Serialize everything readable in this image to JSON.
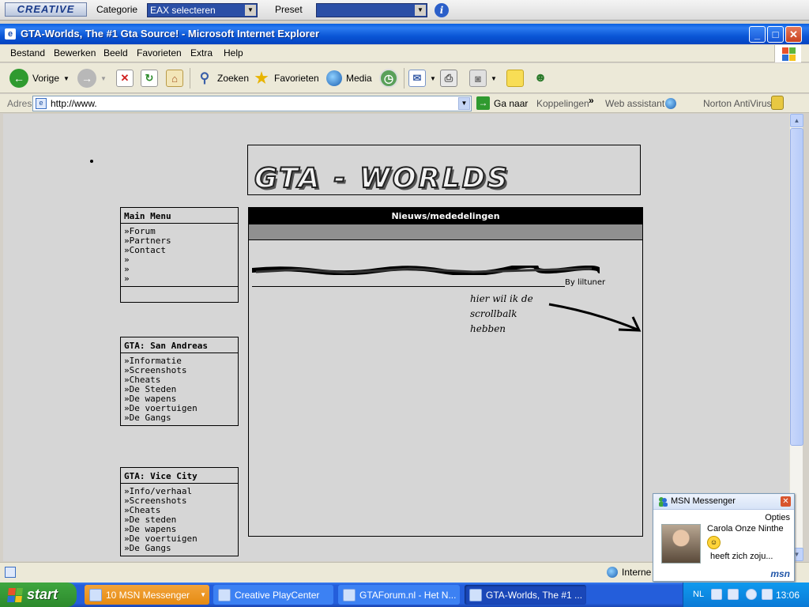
{
  "creative_bar": {
    "logo": "CREATIVE",
    "category_label": "Categorie",
    "category_value": "EAX selecteren",
    "preset_label": "Preset",
    "preset_value": ""
  },
  "window": {
    "title": "GTA-Worlds, The #1 Gta Source! - Microsoft Internet Explorer"
  },
  "menubar": [
    "Bestand",
    "Bewerken",
    "Beeld",
    "Favorieten",
    "Extra",
    "Help"
  ],
  "toolbar": {
    "back": "Vorige",
    "search": "Zoeken",
    "favorites": "Favorieten",
    "media": "Media"
  },
  "addressbar": {
    "label": "Adres",
    "url": "http://www.",
    "go": "Ga naar",
    "links": "Koppelingen",
    "web_assistant": "Web assistant",
    "norton": "Norton AntiVirus"
  },
  "page": {
    "logo_text": "GTA - WORLDS",
    "main_menu": {
      "title": "Main Menu",
      "items": [
        "»Forum",
        "»Partners",
        "»Contact",
        "»",
        "»",
        "»"
      ]
    },
    "san_andreas": {
      "title": "GTA: San Andreas",
      "items": [
        "»Informatie",
        "»Screenshots",
        "»Cheats",
        "»De Steden",
        "»De wapens",
        "»De voertuigen",
        "»De Gangs"
      ]
    },
    "vice_city": {
      "title": "GTA: Vice City",
      "items": [
        "»Info/verhaal",
        "»Screenshots",
        "»Cheats",
        "»De steden",
        "»De wapens",
        "»De voertuigen",
        "»De Gangs"
      ]
    },
    "news": {
      "title": "Nieuws/mededelingen",
      "author": "By liltuner",
      "note": [
        "hier wil ik de",
        "scrollbalk",
        "hebben"
      ]
    }
  },
  "statusbar": {
    "zone": "Interne"
  },
  "msn_popup": {
    "title": "MSN Messenger",
    "options": "Opties",
    "contact": "Carola Onze Ninthe",
    "message": "heeft zich zoju...",
    "brand": "msn"
  },
  "taskbar": {
    "start": "start",
    "tasks": [
      "10 MSN Messenger",
      "Creative PlayCenter",
      "GTAForum.nl - Het N...",
      "GTA-Worlds, The #1 ..."
    ],
    "language": "NL",
    "clock": "13:06"
  },
  "colors": {
    "titlebar": "#0a5fe0",
    "taskbar": "#245edb",
    "start_button": "#3fa63f",
    "page_background": "#d6d6d6",
    "news_header": "#000000"
  },
  "icons": [
    "back-icon",
    "forward-icon",
    "stop-icon",
    "refresh-icon",
    "home-icon",
    "search-icon",
    "favorites-star-icon",
    "media-icon",
    "history-icon",
    "mail-icon",
    "print-icon",
    "edit-icon",
    "discuss-icon",
    "messenger-icon",
    "go-arrow-icon",
    "globe-icon",
    "windows-flag-icon"
  ]
}
